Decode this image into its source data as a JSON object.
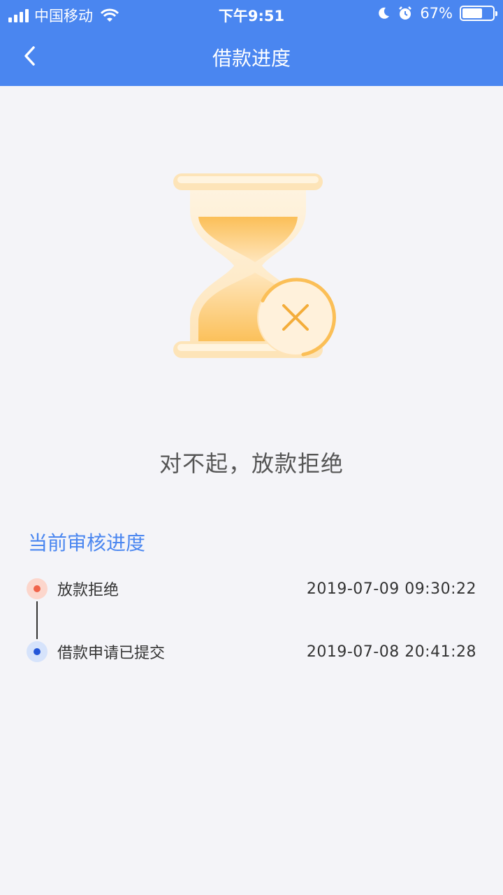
{
  "status_bar": {
    "carrier": "中国移动",
    "time": "下午9:51",
    "battery": "67%",
    "battery_level": 0.67
  },
  "nav": {
    "title": "借款进度"
  },
  "result": {
    "message": "对不起，放款拒绝"
  },
  "progress": {
    "title": "当前审核进度",
    "steps": [
      {
        "label": "放款拒绝",
        "time": "2019-07-09 09:30:22",
        "status": "rejected"
      },
      {
        "label": "借款申请已提交",
        "time": "2019-07-08 20:41:28",
        "status": "submitted"
      }
    ]
  },
  "colors": {
    "header": "#4a86f0",
    "accent": "#4a86f0",
    "rejected_dot": "#f0634a",
    "submitted_dot": "#2456d8",
    "hourglass": "#fbbf57"
  }
}
